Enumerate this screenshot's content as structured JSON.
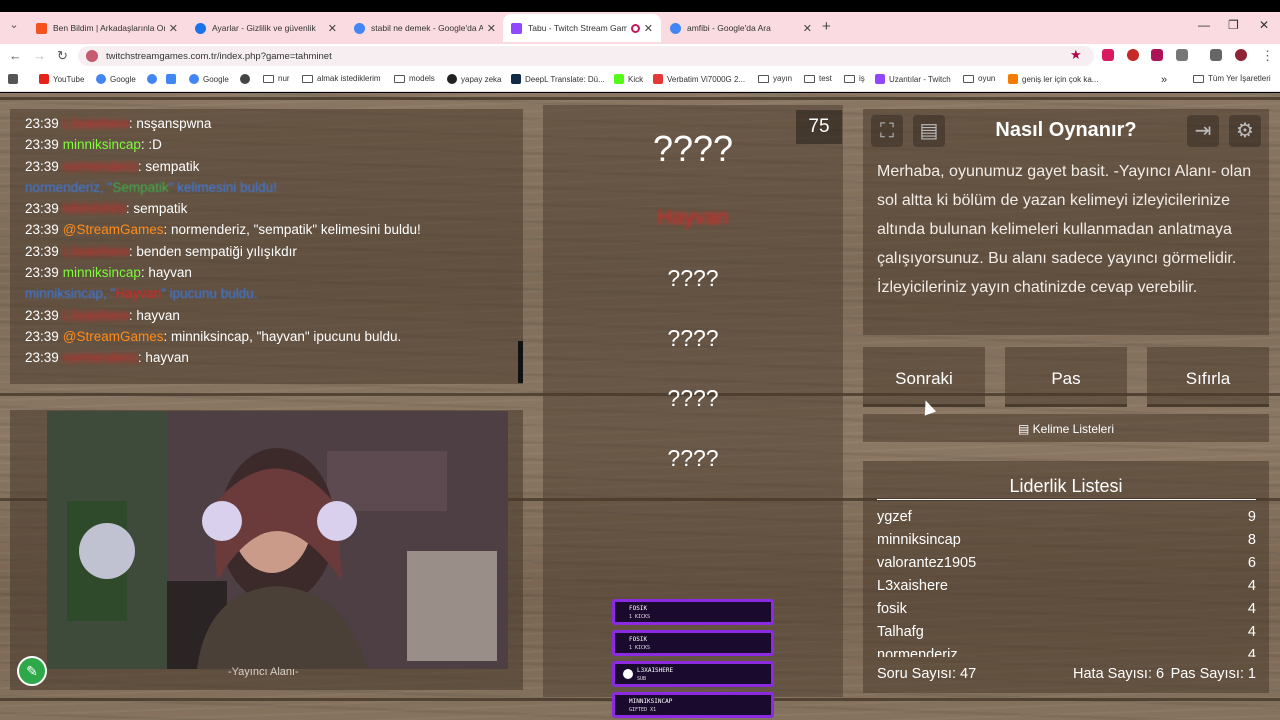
{
  "browser": {
    "tabs": [
      {
        "title": "Ben Bildim | Arkadaşlarınla Onli",
        "color": "#f4511e"
      },
      {
        "title": "Ayarlar - Gizlilik ve güvenlik",
        "color": "#1a73e8"
      },
      {
        "title": "stabil ne demek - Google'da Ara",
        "color": "#4285f4"
      },
      {
        "title": "Tabu - Twitch Stream Game",
        "color": "#9146ff"
      },
      {
        "title": "amfibi - Google'da Ara",
        "color": "#4285f4"
      }
    ],
    "url": "twitchstreamgames.com.tr/index.php?game=tahminet",
    "bookmarks": [
      {
        "label": "YouTube",
        "icon": "youtube-icon",
        "color": "#e62117"
      },
      {
        "label": "Google",
        "icon": "google-icon",
        "color": "#4285f4"
      },
      {
        "label": "",
        "icon": "google-icon",
        "color": "#4285f4"
      },
      {
        "label": "",
        "icon": "translate-icon",
        "color": "#4285f4"
      },
      {
        "label": "Google",
        "icon": "google-icon",
        "color": "#4285f4"
      },
      {
        "label": "",
        "icon": "globe-icon",
        "color": "#444444"
      },
      {
        "label": "nur",
        "icon": "folder-icon",
        "color": ""
      },
      {
        "label": "almak istediklerim",
        "icon": "folder-icon",
        "color": ""
      },
      {
        "label": "models",
        "icon": "folder-icon",
        "color": ""
      },
      {
        "label": "yapay zeka",
        "icon": "openai-icon",
        "color": "#222222"
      },
      {
        "label": "DeepL Translate: Dü...",
        "icon": "deepl-icon",
        "color": "#0f2b46"
      },
      {
        "label": "Kick",
        "icon": "kick-icon",
        "color": "#53fc18"
      },
      {
        "label": "Verbatim Vi7000G 2...",
        "icon": "shop-icon",
        "color": "#e53935"
      },
      {
        "label": "yayın",
        "icon": "folder-icon",
        "color": ""
      },
      {
        "label": "test",
        "icon": "folder-icon",
        "color": ""
      },
      {
        "label": "iş",
        "icon": "folder-icon",
        "color": ""
      },
      {
        "label": "Uzantılar - Twitch",
        "icon": "twitch-icon",
        "color": "#9146ff"
      },
      {
        "label": "oyun",
        "icon": "folder-icon",
        "color": ""
      },
      {
        "label": "geniş ler için çok ka...",
        "icon": "bookmark-icon",
        "color": "#f57c00"
      }
    ],
    "all_bookmarks": "Tüm Yer İşaretleri"
  },
  "chat": {
    "lines": [
      {
        "time": "23:39",
        "user": "L3xaishere",
        "user_color": "red",
        "text": ": nsşanspwna"
      },
      {
        "time": "23:39",
        "user": "minniksincap",
        "user_color": "green",
        "text": ": :D"
      },
      {
        "time": "23:39",
        "user": "normenderiz",
        "user_color": "red",
        "text": ": sempatik"
      },
      {
        "system": true,
        "pre": "normenderiz, \"",
        "word": "Sempatik",
        "post": "\" kelimesini buldu!"
      },
      {
        "time": "23:39",
        "user": "hihihihihihi",
        "user_color": "red",
        "text": ": sempatik"
      },
      {
        "time": "23:39",
        "user": "@StreamGames",
        "user_color": "orange",
        "text": ": normenderiz, \"sempatik\" kelimesini buldu!"
      },
      {
        "time": "23:39",
        "user": "L3xaishere",
        "user_color": "red",
        "text": ": benden sempatiği yılışıkdır"
      },
      {
        "time": "23:39",
        "user": "minniksincap",
        "user_color": "green",
        "text": ": hayvan"
      },
      {
        "system": true,
        "pre": "minniksincap, \"",
        "word": "Hayvan",
        "post": "\" ipucunu buldu.",
        "word_red": true
      },
      {
        "time": "23:39",
        "user": "L3xaishere",
        "user_color": "red",
        "text": ": hayvan"
      },
      {
        "time": "23:39",
        "user": "@StreamGames",
        "user_color": "orange",
        "text": ": minniksincap, \"hayvan\" ipucunu buldu."
      },
      {
        "time": "23:39",
        "user": "normenderiz",
        "user_color": "red",
        "text": ": hayvan"
      }
    ]
  },
  "camera": {
    "caption": "-Yayıncı Alanı-"
  },
  "game": {
    "timer": "75",
    "main_word": "????",
    "found_hint": "Hayvan",
    "hints": [
      "????",
      "????",
      "????",
      "????"
    ]
  },
  "alerts": [
    {
      "name": "FOSIK",
      "sub": "1 KICKS"
    },
    {
      "name": "FOSIK",
      "sub": "1 KICKS"
    },
    {
      "name": "L3XAISHERE",
      "sub": "SUB"
    },
    {
      "name": "MINNIKSINCAP",
      "sub": "GIFTED X1"
    }
  ],
  "howto": {
    "title": "Nasıl Oynanır?",
    "text": "Merhaba, oyunumuz gayet basit. -Yayıncı Alanı- olan sol altta ki bölüm de yazan kelimeyi izleyicilerinize altında bulunan kelimeleri kullanmadan anlatmaya çalışıyorsunuz. Bu alanı sadece yayıncı görmelidir. İzleyicileriniz yayın chatinizde cevap verebilir."
  },
  "controls": {
    "next": "Sonraki",
    "pass": "Pas",
    "reset": "Sıfırla",
    "word_lists": "Kelime Listeleri"
  },
  "leaderboard": {
    "title": "Liderlik Listesi",
    "rows": [
      {
        "name": "ygzef",
        "score": "9"
      },
      {
        "name": "minniksincap",
        "score": "8"
      },
      {
        "name": "valorantez1905",
        "score": "6"
      },
      {
        "name": "L3xaishere",
        "score": "4"
      },
      {
        "name": "fosik",
        "score": "4"
      },
      {
        "name": "Talhafg",
        "score": "4"
      },
      {
        "name": "normenderiz",
        "score": "4"
      }
    ]
  },
  "stats": {
    "questions": "Soru Sayısı: 47",
    "errors": "Hata Sayısı: 6",
    "passes": "Pas Sayısı: 1"
  }
}
